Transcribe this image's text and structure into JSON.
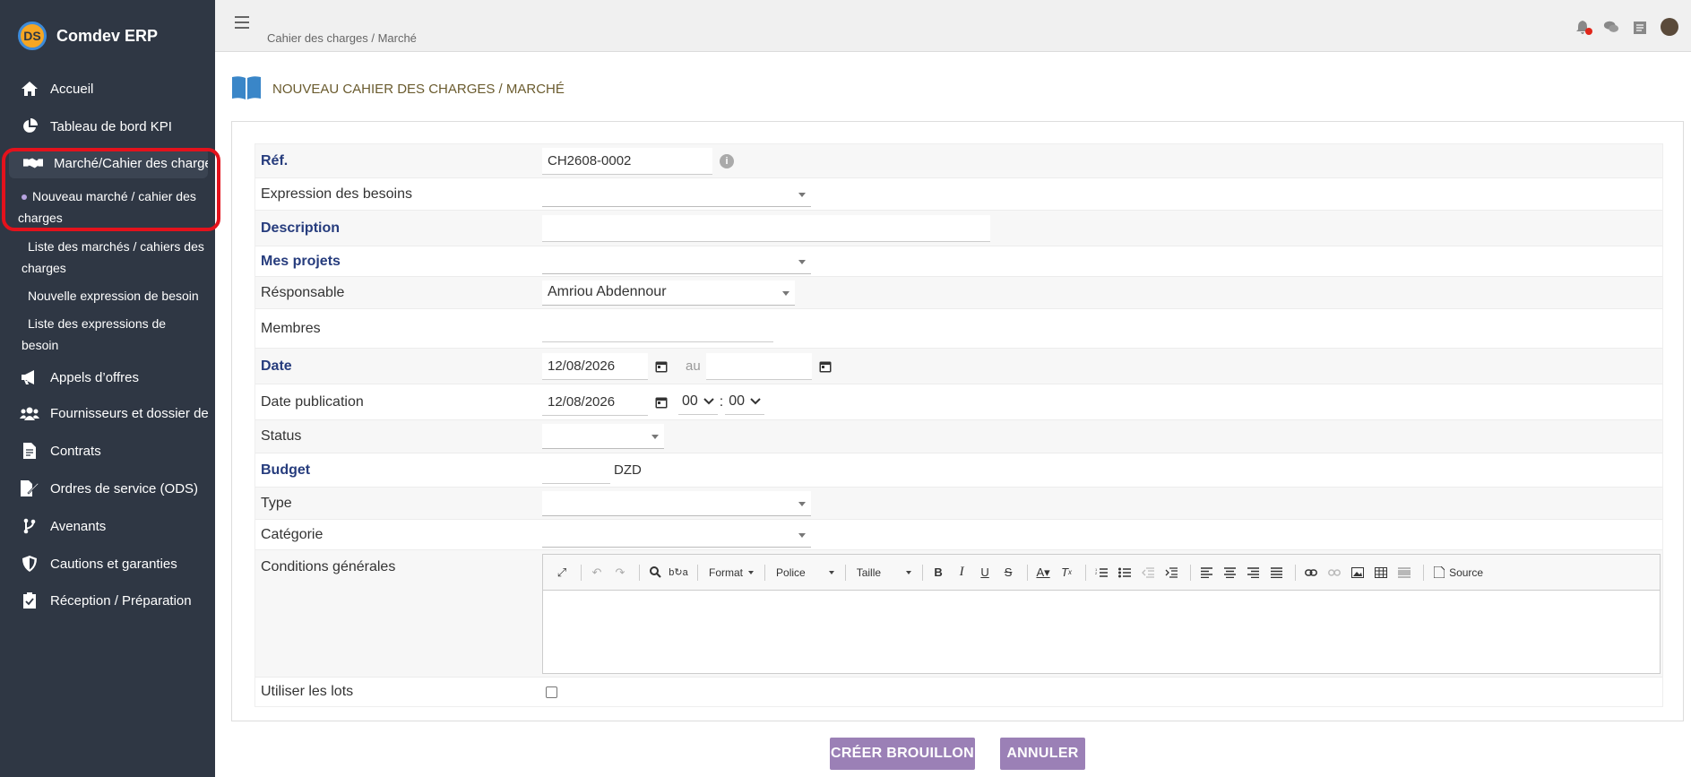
{
  "app": {
    "name": "Comdev ERP",
    "logo_text": "DS"
  },
  "sidebar": {
    "items": [
      {
        "label": "Accueil",
        "icon": "home-icon"
      },
      {
        "label": "Tableau de bord KPI",
        "icon": "pie-chart-icon"
      },
      {
        "label": "Marché/Cahier des charges",
        "icon": "handshake-icon"
      },
      {
        "label": "Appels d’offres",
        "icon": "megaphone-icon"
      },
      {
        "label": "Fournisseurs et dossier de",
        "icon": "users-icon"
      },
      {
        "label": "Contrats",
        "icon": "file-icon"
      },
      {
        "label": "Ordres de service (ODS)",
        "icon": "file-signature-icon"
      },
      {
        "label": "Avenants",
        "icon": "code-branch-icon"
      },
      {
        "label": "Cautions et garanties",
        "icon": "shield-icon"
      },
      {
        "label": "Réception / Préparation",
        "icon": "clipboard-check-icon"
      }
    ],
    "subitems": [
      {
        "line1": "Nouveau marché / cahier des",
        "line2": "charges"
      },
      {
        "line1": "Liste des marchés / cahiers des",
        "line2": "charges"
      },
      {
        "line1": "Nouvelle expression de besoin",
        "line2": ""
      },
      {
        "line1": "Liste des expressions de",
        "line2": "besoin"
      }
    ]
  },
  "topbar": {
    "breadcrumb": "Cahier des charges / Marché"
  },
  "page": {
    "title": "NOUVEAU CAHIER DES CHARGES / MARCHÉ"
  },
  "form": {
    "ref_label": "Réf.",
    "ref_value": "CH2608-0002",
    "expression_label": "Expression des besoins",
    "description_label": "Description",
    "projets_label": "Mes projets",
    "responsable_label": "Résponsable",
    "responsable_value": "Amriou Abdennour",
    "membres_label": "Membres",
    "date_label": "Date",
    "date_start": "12/08/2026",
    "date_to": "au",
    "date_publication_label": "Date publication",
    "date_publication_value": "12/08/2026",
    "hour": "00",
    "minute": "00",
    "time_separator": ":",
    "status_label": "Status",
    "budget_label": "Budget",
    "budget_currency": "DZD",
    "type_label": "Type",
    "categorie_label": "Catégorie",
    "conditions_label": "Conditions générales",
    "lots_label": "Utiliser les lots"
  },
  "editor": {
    "format": "Format",
    "police": "Police",
    "taille": "Taille",
    "source": "Source"
  },
  "buttons": {
    "create": "CRÉER BROUILLON",
    "cancel": "ANNULER"
  },
  "colors": {
    "sidebar_bg": "#2f3744",
    "button_bg": "#9b80b6",
    "label_blue": "#263c7d",
    "highlight_red": "#e4121c"
  }
}
